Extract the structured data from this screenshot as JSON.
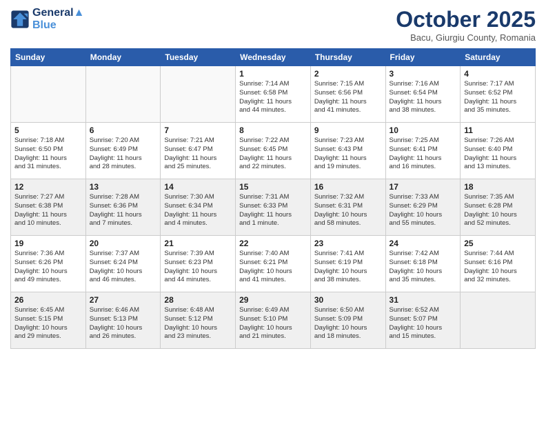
{
  "header": {
    "logo_line1": "General",
    "logo_line2": "Blue",
    "month": "October 2025",
    "location": "Bacu, Giurgiu County, Romania"
  },
  "days_of_week": [
    "Sunday",
    "Monday",
    "Tuesday",
    "Wednesday",
    "Thursday",
    "Friday",
    "Saturday"
  ],
  "weeks": [
    {
      "shaded": false,
      "cells": [
        {
          "day": "",
          "num": "",
          "lines": []
        },
        {
          "day": "",
          "num": "",
          "lines": []
        },
        {
          "day": "",
          "num": "",
          "lines": []
        },
        {
          "day": "",
          "num": "1",
          "lines": [
            "Sunrise: 7:14 AM",
            "Sunset: 6:58 PM",
            "Daylight: 11 hours",
            "and 44 minutes."
          ]
        },
        {
          "day": "",
          "num": "2",
          "lines": [
            "Sunrise: 7:15 AM",
            "Sunset: 6:56 PM",
            "Daylight: 11 hours",
            "and 41 minutes."
          ]
        },
        {
          "day": "",
          "num": "3",
          "lines": [
            "Sunrise: 7:16 AM",
            "Sunset: 6:54 PM",
            "Daylight: 11 hours",
            "and 38 minutes."
          ]
        },
        {
          "day": "",
          "num": "4",
          "lines": [
            "Sunrise: 7:17 AM",
            "Sunset: 6:52 PM",
            "Daylight: 11 hours",
            "and 35 minutes."
          ]
        }
      ]
    },
    {
      "shaded": false,
      "cells": [
        {
          "day": "",
          "num": "5",
          "lines": [
            "Sunrise: 7:18 AM",
            "Sunset: 6:50 PM",
            "Daylight: 11 hours",
            "and 31 minutes."
          ]
        },
        {
          "day": "",
          "num": "6",
          "lines": [
            "Sunrise: 7:20 AM",
            "Sunset: 6:49 PM",
            "Daylight: 11 hours",
            "and 28 minutes."
          ]
        },
        {
          "day": "",
          "num": "7",
          "lines": [
            "Sunrise: 7:21 AM",
            "Sunset: 6:47 PM",
            "Daylight: 11 hours",
            "and 25 minutes."
          ]
        },
        {
          "day": "",
          "num": "8",
          "lines": [
            "Sunrise: 7:22 AM",
            "Sunset: 6:45 PM",
            "Daylight: 11 hours",
            "and 22 minutes."
          ]
        },
        {
          "day": "",
          "num": "9",
          "lines": [
            "Sunrise: 7:23 AM",
            "Sunset: 6:43 PM",
            "Daylight: 11 hours",
            "and 19 minutes."
          ]
        },
        {
          "day": "",
          "num": "10",
          "lines": [
            "Sunrise: 7:25 AM",
            "Sunset: 6:41 PM",
            "Daylight: 11 hours",
            "and 16 minutes."
          ]
        },
        {
          "day": "",
          "num": "11",
          "lines": [
            "Sunrise: 7:26 AM",
            "Sunset: 6:40 PM",
            "Daylight: 11 hours",
            "and 13 minutes."
          ]
        }
      ]
    },
    {
      "shaded": true,
      "cells": [
        {
          "day": "",
          "num": "12",
          "lines": [
            "Sunrise: 7:27 AM",
            "Sunset: 6:38 PM",
            "Daylight: 11 hours",
            "and 10 minutes."
          ]
        },
        {
          "day": "",
          "num": "13",
          "lines": [
            "Sunrise: 7:28 AM",
            "Sunset: 6:36 PM",
            "Daylight: 11 hours",
            "and 7 minutes."
          ]
        },
        {
          "day": "",
          "num": "14",
          "lines": [
            "Sunrise: 7:30 AM",
            "Sunset: 6:34 PM",
            "Daylight: 11 hours",
            "and 4 minutes."
          ]
        },
        {
          "day": "",
          "num": "15",
          "lines": [
            "Sunrise: 7:31 AM",
            "Sunset: 6:33 PM",
            "Daylight: 11 hours",
            "and 1 minute."
          ]
        },
        {
          "day": "",
          "num": "16",
          "lines": [
            "Sunrise: 7:32 AM",
            "Sunset: 6:31 PM",
            "Daylight: 10 hours",
            "and 58 minutes."
          ]
        },
        {
          "day": "",
          "num": "17",
          "lines": [
            "Sunrise: 7:33 AM",
            "Sunset: 6:29 PM",
            "Daylight: 10 hours",
            "and 55 minutes."
          ]
        },
        {
          "day": "",
          "num": "18",
          "lines": [
            "Sunrise: 7:35 AM",
            "Sunset: 6:28 PM",
            "Daylight: 10 hours",
            "and 52 minutes."
          ]
        }
      ]
    },
    {
      "shaded": false,
      "cells": [
        {
          "day": "",
          "num": "19",
          "lines": [
            "Sunrise: 7:36 AM",
            "Sunset: 6:26 PM",
            "Daylight: 10 hours",
            "and 49 minutes."
          ]
        },
        {
          "day": "",
          "num": "20",
          "lines": [
            "Sunrise: 7:37 AM",
            "Sunset: 6:24 PM",
            "Daylight: 10 hours",
            "and 46 minutes."
          ]
        },
        {
          "day": "",
          "num": "21",
          "lines": [
            "Sunrise: 7:39 AM",
            "Sunset: 6:23 PM",
            "Daylight: 10 hours",
            "and 44 minutes."
          ]
        },
        {
          "day": "",
          "num": "22",
          "lines": [
            "Sunrise: 7:40 AM",
            "Sunset: 6:21 PM",
            "Daylight: 10 hours",
            "and 41 minutes."
          ]
        },
        {
          "day": "",
          "num": "23",
          "lines": [
            "Sunrise: 7:41 AM",
            "Sunset: 6:19 PM",
            "Daylight: 10 hours",
            "and 38 minutes."
          ]
        },
        {
          "day": "",
          "num": "24",
          "lines": [
            "Sunrise: 7:42 AM",
            "Sunset: 6:18 PM",
            "Daylight: 10 hours",
            "and 35 minutes."
          ]
        },
        {
          "day": "",
          "num": "25",
          "lines": [
            "Sunrise: 7:44 AM",
            "Sunset: 6:16 PM",
            "Daylight: 10 hours",
            "and 32 minutes."
          ]
        }
      ]
    },
    {
      "shaded": true,
      "cells": [
        {
          "day": "",
          "num": "26",
          "lines": [
            "Sunrise: 6:45 AM",
            "Sunset: 5:15 PM",
            "Daylight: 10 hours",
            "and 29 minutes."
          ]
        },
        {
          "day": "",
          "num": "27",
          "lines": [
            "Sunrise: 6:46 AM",
            "Sunset: 5:13 PM",
            "Daylight: 10 hours",
            "and 26 minutes."
          ]
        },
        {
          "day": "",
          "num": "28",
          "lines": [
            "Sunrise: 6:48 AM",
            "Sunset: 5:12 PM",
            "Daylight: 10 hours",
            "and 23 minutes."
          ]
        },
        {
          "day": "",
          "num": "29",
          "lines": [
            "Sunrise: 6:49 AM",
            "Sunset: 5:10 PM",
            "Daylight: 10 hours",
            "and 21 minutes."
          ]
        },
        {
          "day": "",
          "num": "30",
          "lines": [
            "Sunrise: 6:50 AM",
            "Sunset: 5:09 PM",
            "Daylight: 10 hours",
            "and 18 minutes."
          ]
        },
        {
          "day": "",
          "num": "31",
          "lines": [
            "Sunrise: 6:52 AM",
            "Sunset: 5:07 PM",
            "Daylight: 10 hours",
            "and 15 minutes."
          ]
        },
        {
          "day": "",
          "num": "",
          "lines": []
        }
      ]
    }
  ]
}
